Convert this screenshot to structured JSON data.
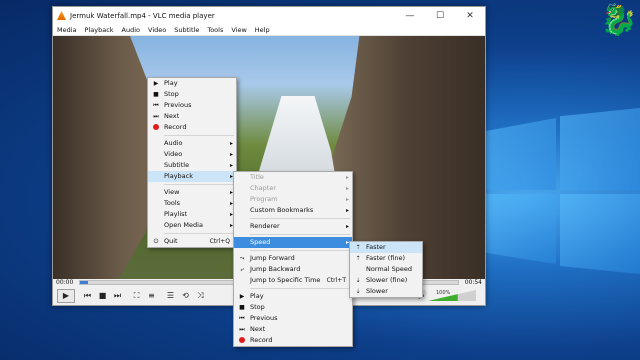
{
  "window": {
    "title": "Jermuk Waterfall.mp4 - VLC media player",
    "minimize": "—",
    "maximize": "☐",
    "close": "✕"
  },
  "menubar": [
    "Media",
    "Playback",
    "Audio",
    "Video",
    "Subtitle",
    "Tools",
    "View",
    "Help"
  ],
  "player": {
    "time_elapsed": "00:00",
    "time_total": "00:54",
    "progress": 0.02,
    "volume_percent": "100%",
    "volume_level": 0.62
  },
  "main_menu": {
    "group1": [
      {
        "label": "Play",
        "icon": "play-icon"
      },
      {
        "label": "Stop",
        "icon": "stop-icon"
      },
      {
        "label": "Previous",
        "icon": "previous-icon"
      },
      {
        "label": "Next",
        "icon": "next-icon"
      },
      {
        "label": "Record",
        "icon": "record-icon"
      }
    ],
    "group2": [
      "Audio",
      "Video",
      "Subtitle",
      "Playback"
    ],
    "group3": [
      "View",
      "Tools",
      "Playlist",
      "Open Media"
    ],
    "quit": {
      "label": "Quit",
      "shortcut": "Ctrl+Q"
    }
  },
  "playback_menu": {
    "disabled": [
      "Title",
      "Chapter",
      "Program"
    ],
    "custom_bookmarks": "Custom Bookmarks",
    "renderer": "Renderer",
    "speed": "Speed",
    "jump": [
      "Jump Forward",
      "Jump Backward"
    ],
    "jump_time": {
      "label": "Jump to Specific Time",
      "shortcut": "Ctrl+T"
    },
    "transport": [
      {
        "label": "Play",
        "icon": "play-icon"
      },
      {
        "label": "Stop",
        "icon": "stop-icon"
      },
      {
        "label": "Previous",
        "icon": "previous-icon"
      },
      {
        "label": "Next",
        "icon": "next-icon"
      },
      {
        "label": "Record",
        "icon": "record-icon"
      }
    ]
  },
  "speed_menu": [
    "Faster",
    "Faster (fine)",
    "Normal Speed",
    "Slower (fine)",
    "Slower"
  ],
  "colors": {
    "accent": "#3c8de0",
    "highlight": "#cce4f7",
    "record": "#e01b1b",
    "vlc_orange": "#ff8800"
  }
}
